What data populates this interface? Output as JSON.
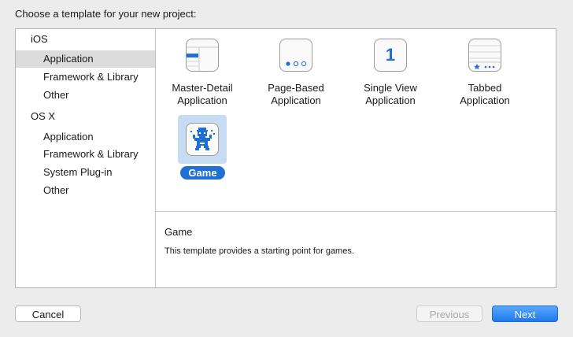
{
  "heading": "Choose a template for your new project:",
  "sidebar": {
    "groups": [
      {
        "label": "iOS",
        "items": [
          "Application",
          "Framework & Library",
          "Other"
        ]
      },
      {
        "label": "OS X",
        "items": [
          "Application",
          "Framework & Library",
          "System Plug-in",
          "Other"
        ]
      }
    ],
    "selected": "iOS / Application"
  },
  "templates": [
    {
      "line1": "Master-Detail",
      "line2": "Application",
      "icon": "master-detail-icon"
    },
    {
      "line1": "Page-Based",
      "line2": "Application",
      "icon": "page-based-icon"
    },
    {
      "line1": "Single View",
      "line2": "Application",
      "icon": "single-view-icon"
    },
    {
      "line1": "Tabbed",
      "line2": "Application",
      "icon": "tabbed-icon"
    },
    {
      "line1": "Game",
      "line2": "",
      "icon": "game-icon",
      "selected": true
    }
  ],
  "single_view_glyph": "1",
  "description": {
    "title": "Game",
    "text": "This template provides a starting point for games."
  },
  "buttons": {
    "cancel": "Cancel",
    "previous": "Previous",
    "next": "Next"
  },
  "colors": {
    "accent": "#1f6fd4",
    "selection_bg": "#c7dcf2",
    "sidebar_selection": "#dcdcdc"
  }
}
